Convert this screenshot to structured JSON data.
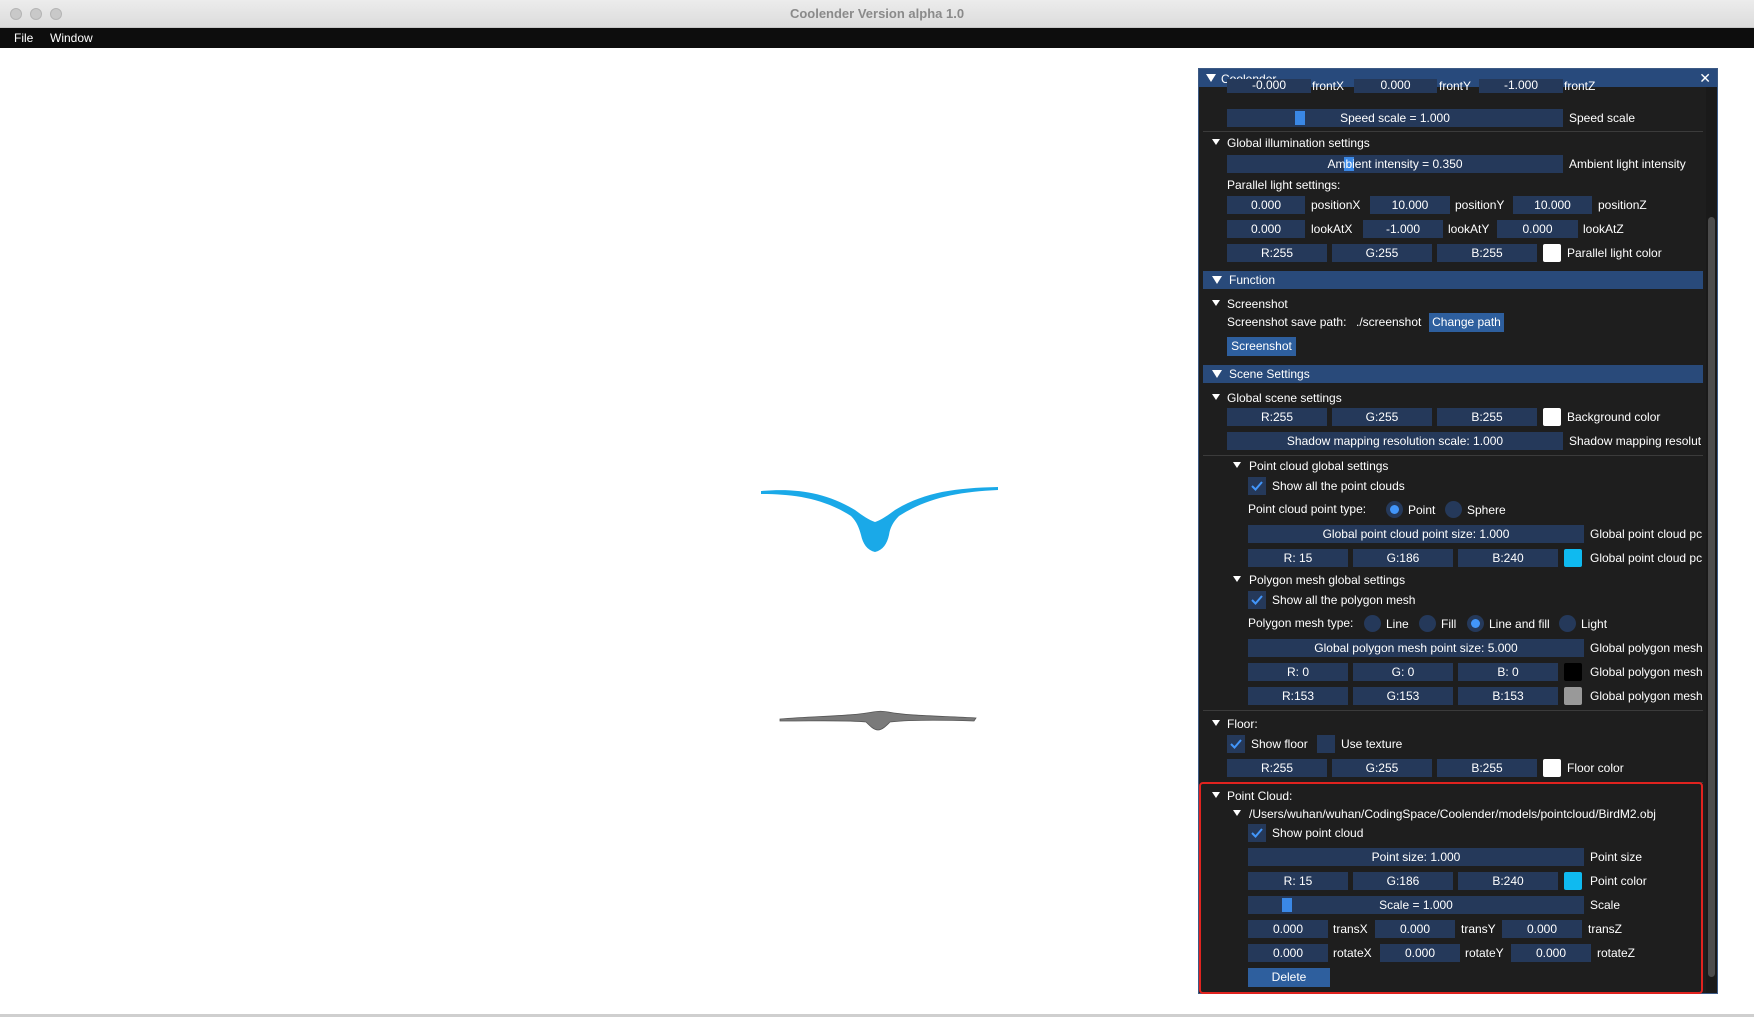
{
  "window": {
    "title": "Coolender Version alpha 1.0"
  },
  "menu": {
    "items": [
      "File",
      "Window"
    ]
  },
  "panel": {
    "title": "Coolender",
    "camera": {
      "frontX": {
        "value": "-0.000",
        "label": "frontX"
      },
      "frontY": {
        "value": "0.000",
        "label": "frontY"
      },
      "frontZ": {
        "value": "-1.000",
        "label": "frontZ"
      },
      "speed": {
        "value": "Speed scale = 1.000",
        "label": "Speed scale",
        "fraction": 0.15
      }
    },
    "global_illumination": {
      "header": "Global illumination settings",
      "ambient": {
        "value": "Ambient intensity = 0.350",
        "label": "Ambient light intensity",
        "fraction": 0.35
      },
      "parallel_label": "Parallel light settings:",
      "position": {
        "x": "0.000",
        "x_label": "positionX",
        "y": "10.000",
        "y_label": "positionY",
        "z": "10.000",
        "z_label": "positionZ"
      },
      "look": {
        "x": "0.000",
        "x_label": "lookAtX",
        "y": "-1.000",
        "y_label": "lookAtY",
        "z": "0.000",
        "z_label": "lookAtZ"
      },
      "color": {
        "r": "R:255",
        "g": "G:255",
        "b": "B:255",
        "label": "Parallel light color",
        "swatch": "#ffffff"
      }
    },
    "function": {
      "header": "Function",
      "screenshot": {
        "header": "Screenshot",
        "path_label": "Screenshot save path:",
        "path_value": "./screenshot",
        "change_button": "Change path",
        "screenshot_button": "Screenshot"
      }
    },
    "scene": {
      "header": "Scene Settings",
      "global_header": "Global scene settings",
      "bg": {
        "r": "R:255",
        "g": "G:255",
        "b": "B:255",
        "label": "Background color",
        "swatch": "#ffffff"
      },
      "shadow": {
        "value": "Shadow mapping resolution scale: 1.000",
        "label": "Shadow mapping resolut"
      },
      "point_cloud_global": {
        "header": "Point cloud global settings",
        "show_label": "Show all the point clouds",
        "type_label": "Point cloud point type:",
        "type_point": "Point",
        "type_sphere": "Sphere",
        "size": {
          "value": "Global point cloud point size: 1.000",
          "label": "Global point cloud pc"
        },
        "color": {
          "r": "R: 15",
          "g": "G:186",
          "b": "B:240",
          "label": "Global point cloud pc",
          "swatch": "#0fbaf0"
        }
      },
      "polygon_global": {
        "header": "Polygon mesh global settings",
        "show_label": "Show all the polygon mesh",
        "type_label": "Polygon mesh type:",
        "types": [
          "Line",
          "Fill",
          "Line and fill",
          "Light"
        ],
        "size": {
          "value": "Global polygon mesh point size: 5.000",
          "label": "Global polygon mesh"
        },
        "color1": {
          "r": "R:  0",
          "g": "G:  0",
          "b": "B:  0",
          "label": "Global polygon mesh",
          "swatch": "#000000"
        },
        "color2": {
          "r": "R:153",
          "g": "G:153",
          "b": "B:153",
          "label": "Global polygon mesh",
          "swatch": "#999999"
        }
      },
      "floor": {
        "header": "Floor:",
        "show_label": "Show floor",
        "texture_label": "Use texture",
        "color": {
          "r": "R:255",
          "g": "G:255",
          "b": "B:255",
          "label": "Floor color",
          "swatch": "#ffffff"
        }
      },
      "point_cloud": {
        "header": "Point Cloud:",
        "file": "/Users/wuhan/wuhan/CodingSpace/Coolender/models/pointcloud/BirdM2.obj",
        "show_label": "Show point cloud",
        "size": {
          "value": "Point size: 1.000",
          "label": "Point size"
        },
        "color": {
          "r": "R: 15",
          "g": "G:186",
          "b": "B:240",
          "label": "Point color",
          "swatch": "#0fbaf0"
        },
        "scale": {
          "value": "Scale = 1.000",
          "label": "Scale",
          "fraction": 0.1
        },
        "trans": {
          "x": "0.000",
          "x_label": "transX",
          "y": "0.000",
          "y_label": "transY",
          "z": "0.000",
          "z_label": "transZ"
        },
        "rotate": {
          "x": "0.000",
          "x_label": "rotateX",
          "y": "0.000",
          "y_label": "rotateY",
          "z": "0.000",
          "z_label": "rotateZ"
        },
        "delete_button": "Delete"
      }
    }
  }
}
